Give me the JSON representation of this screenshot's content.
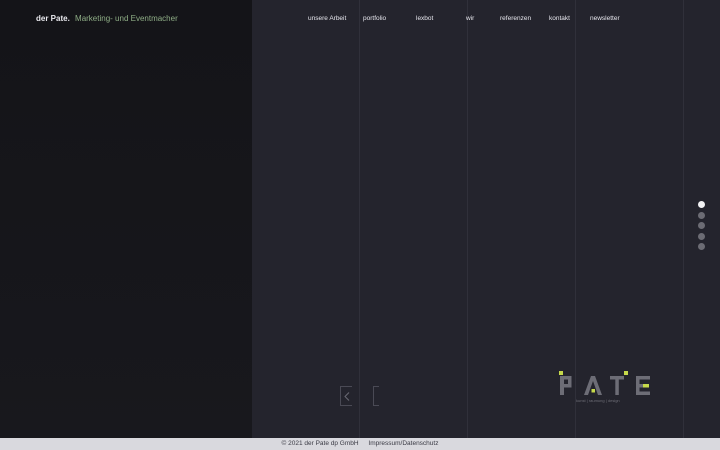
{
  "header": {
    "brand_name": "der Pate.",
    "tagline": "Marketing- und Eventmacher"
  },
  "nav": {
    "items": [
      {
        "label": "unsere Arbeit"
      },
      {
        "label": "portfolio"
      },
      {
        "label": "lexbot"
      },
      {
        "label": "wir"
      },
      {
        "label": "referenzen"
      },
      {
        "label": "kontakt"
      },
      {
        "label": "newsletter"
      }
    ]
  },
  "slider": {
    "page_count": 5,
    "active_page": 1
  },
  "logo": {
    "text": "PATE",
    "subtitle": "kunst | raumung | design",
    "accent_color": "#c6d94a",
    "mark_color": "#6d6d76"
  },
  "footer": {
    "copyright": "© 2021 der Pate dp GmbH",
    "legal_link": "Impressum/Datenschutz"
  },
  "colors": {
    "left_panel": "#141418",
    "right_panel": "#24242d",
    "footer_bg": "#d9d9de"
  }
}
